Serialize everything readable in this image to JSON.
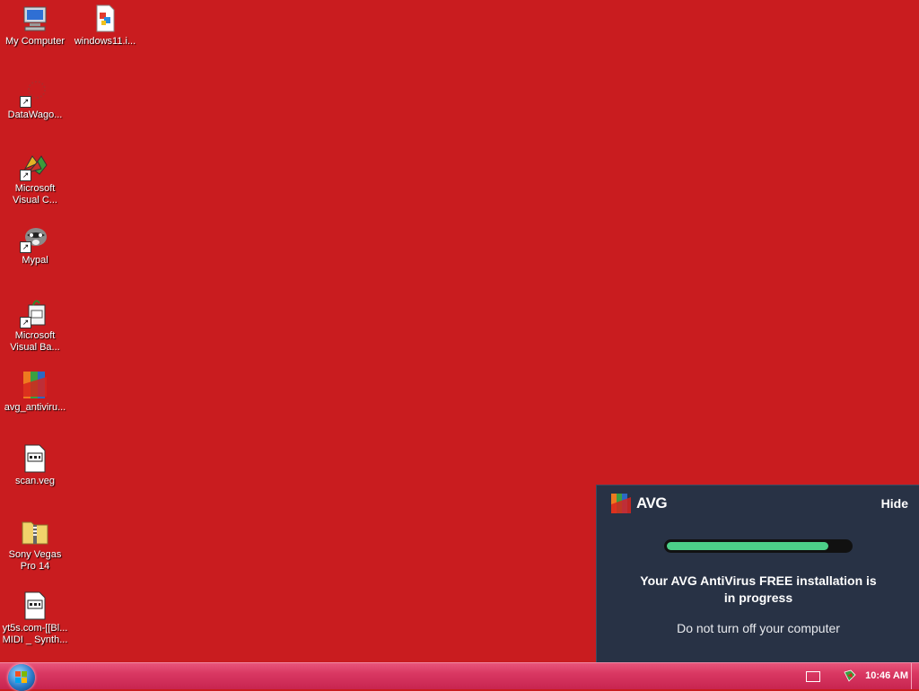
{
  "desktop": {
    "icons": [
      {
        "label": "My Computer",
        "icon": "computer-icon"
      },
      {
        "label": "windows11.i...",
        "icon": "image-file-icon"
      },
      {
        "label": "DataWago...",
        "icon": "datawagon-icon"
      },
      {
        "label": "Microsoft\nVisual C...",
        "icon": "visual-c-icon"
      },
      {
        "label": "Mypal",
        "icon": "mypal-raccoon-icon"
      },
      {
        "label": "Microsoft\nVisual Ba...",
        "icon": "visual-basic-icon"
      },
      {
        "label": "avg_antiviru...",
        "icon": "avg-installer-icon"
      },
      {
        "label": "scan.veg",
        "icon": "veg-file-icon"
      },
      {
        "label": "Sony Vegas\nPro 14",
        "icon": "zip-folder-icon"
      },
      {
        "label": "yt5s.com-[[Bl...\nMIDI _ Synth...",
        "icon": "veg-file-icon"
      }
    ]
  },
  "avg_popup": {
    "brand": "AVG",
    "hide_label": "Hide",
    "progress_fraction": 0.88,
    "message_line1": "Your AVG AntiVirus FREE installation is",
    "message_line2": "in progress",
    "sub_message": "Do not turn off your computer",
    "colors": {
      "background": "#283245",
      "progress": "#4ccf88"
    }
  },
  "taskbar": {
    "clock": "10:46 AM",
    "colors": {
      "taskbar": "#d93762",
      "desktop": "#c91c1f"
    }
  }
}
